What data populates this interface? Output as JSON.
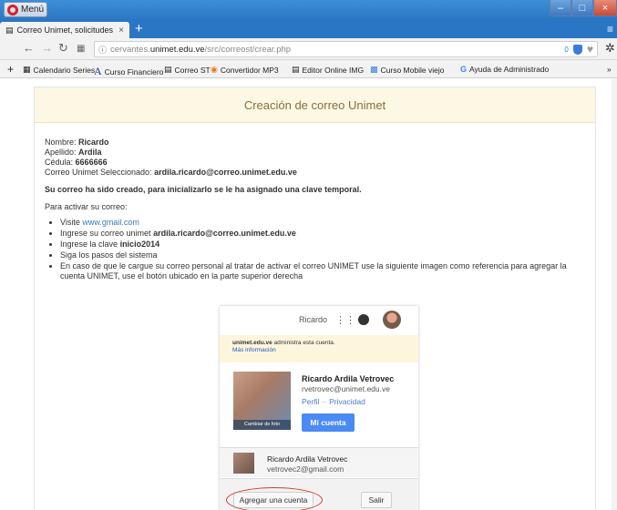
{
  "window": {
    "menu_label": "Menú",
    "min_glyph": "–",
    "max_glyph": "□",
    "close_glyph": "×"
  },
  "tab": {
    "title": "Correo Unimet, solicitudes o",
    "close_glyph": "×",
    "new_tab_glyph": "+",
    "tabmenu_glyph": "≡"
  },
  "address": {
    "url_host": "cervantes.",
    "url_domain": "unimet.edu.ve",
    "url_path": "/src/correost/crear.php",
    "badge": "0"
  },
  "bookmarks": [
    {
      "label": "Calendario Series"
    },
    {
      "label": "Curso Financiero"
    },
    {
      "label": "Correo ST"
    },
    {
      "label": "Convertidor MP3"
    },
    {
      "label": "Editor Online IMG"
    },
    {
      "label": "Curso Mobile viejo"
    },
    {
      "label": "Ayuda de Administrado"
    }
  ],
  "page": {
    "header": "Creación de correo Unimet",
    "nombre_label": "Nombre:",
    "nombre_value": "Ricardo",
    "apellido_label": "Apellido:",
    "apellido_value": "Ardila",
    "cedula_label": "Cédula:",
    "cedula_value": "6666666",
    "correo_label": "Correo Unimet Seleccionado:",
    "correo_value": "ardila.ricardo@correo.unimet.edu.ve",
    "lead": "Su correo ha sido creado, para inicializarlo se le ha asignado una clave temporal.",
    "activar": "Para activar su correo:",
    "step1_prefix": "Visite",
    "step1_link": "www.gmail.com",
    "step2_prefix": "Ingrese su correo unimet",
    "step2_value": "ardila.ricardo@correo.unimet.edu.ve",
    "step3_prefix": "Ingrese la clave",
    "step3_value": "inicio2014",
    "step4": "Siga los pasos del sistema",
    "step5": "En caso de que le cargue su correo personal al tratar de activar el correo UNIMET use la siguiente imagen como referencia para agregar la cuenta UNIMET, use el botón ubicado en la parte superior derecha"
  },
  "google": {
    "top_name": "Ricardo",
    "notice_domain": "unimet.edu.ve",
    "notice_text": " administra esta cuenta.",
    "notice_more": "Más información",
    "change_photo": "Cambiar de foto",
    "account_name": "Ricardo Ardila Vetrovec",
    "account_mail": "rvetrovec@unimet.edu.ve",
    "profile": "Perfil",
    "privacy": "Privacidad",
    "my_account": "Mi cuenta",
    "alt_name": "Ricardo Ardila Vetrovec",
    "alt_mail": "vetrovec2@gmail.com",
    "add_account": "Agregar una cuenta",
    "exit": "Salir"
  }
}
